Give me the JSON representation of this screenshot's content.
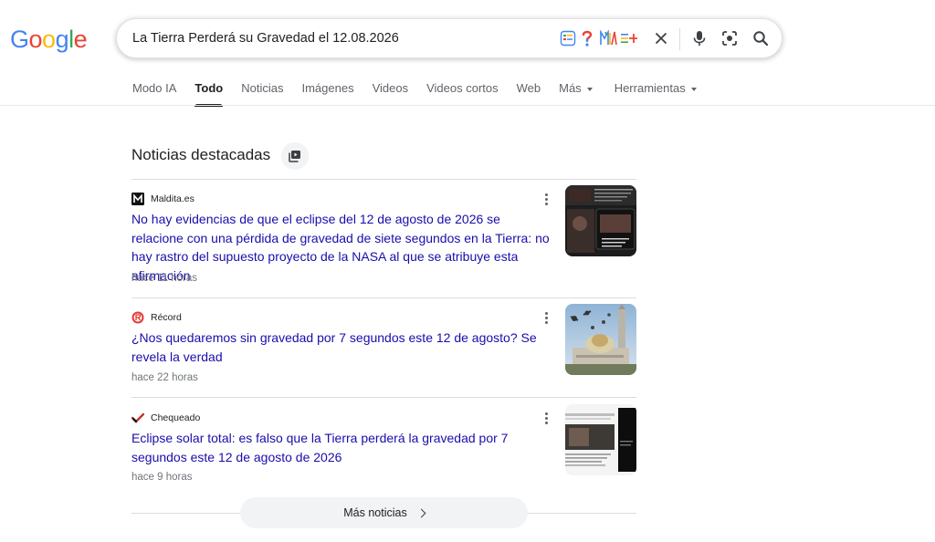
{
  "logo": {
    "letters": [
      "G",
      "o",
      "o",
      "g",
      "l",
      "e"
    ],
    "colors": [
      "#4285f4",
      "#ea4335",
      "#fbbc05",
      "#4285f4",
      "#34a853",
      "#ea4335"
    ]
  },
  "search": {
    "query": "La Tierra Perderá su Gravedad el 12.08.2026",
    "icons": [
      "app-grid-icon",
      "question-icon",
      "translate-icon",
      "add-spark-icon",
      "clear-icon",
      "mic-icon",
      "lens-icon",
      "search-icon"
    ]
  },
  "tabs": [
    {
      "label": "Modo IA",
      "active": false
    },
    {
      "label": "Todo",
      "active": true
    },
    {
      "label": "Noticias",
      "active": false
    },
    {
      "label": "Imágenes",
      "active": false
    },
    {
      "label": "Videos",
      "active": false
    },
    {
      "label": "Videos cortos",
      "active": false
    },
    {
      "label": "Web",
      "active": false
    },
    {
      "label": "Más",
      "active": false,
      "caret": true
    },
    {
      "label": "Herramientas",
      "active": false,
      "caret": true
    }
  ],
  "top_stories": {
    "title": "Noticias destacadas",
    "icon": "stories-icon",
    "items": [
      {
        "source": "Maldita.es",
        "favicon": "maldita-icon",
        "headline": "No hay evidencias de que el eclipse del 12 de agosto de 2026 se relacione con una pérdida de gravedad de siete segundos en la Tierra: no hay rastro del supuesto proyecto de la NASA al que se atribuye esta afirmación",
        "time": "hace 11 horas"
      },
      {
        "source": "Récord",
        "favicon": "record-icon",
        "headline": "¿Nos quedaremos sin gravedad por 7 segundos este 12 de agosto? Se revela la verdad",
        "time": "hace 22 horas"
      },
      {
        "source": "Chequeado",
        "favicon": "chequeado-icon",
        "headline": "Eclipse solar total: es falso que la Tierra perderá la gravedad por 7 segundos este 12 de agosto de 2026",
        "time": "hace 9 horas"
      }
    ],
    "more_label": "Más noticias"
  }
}
